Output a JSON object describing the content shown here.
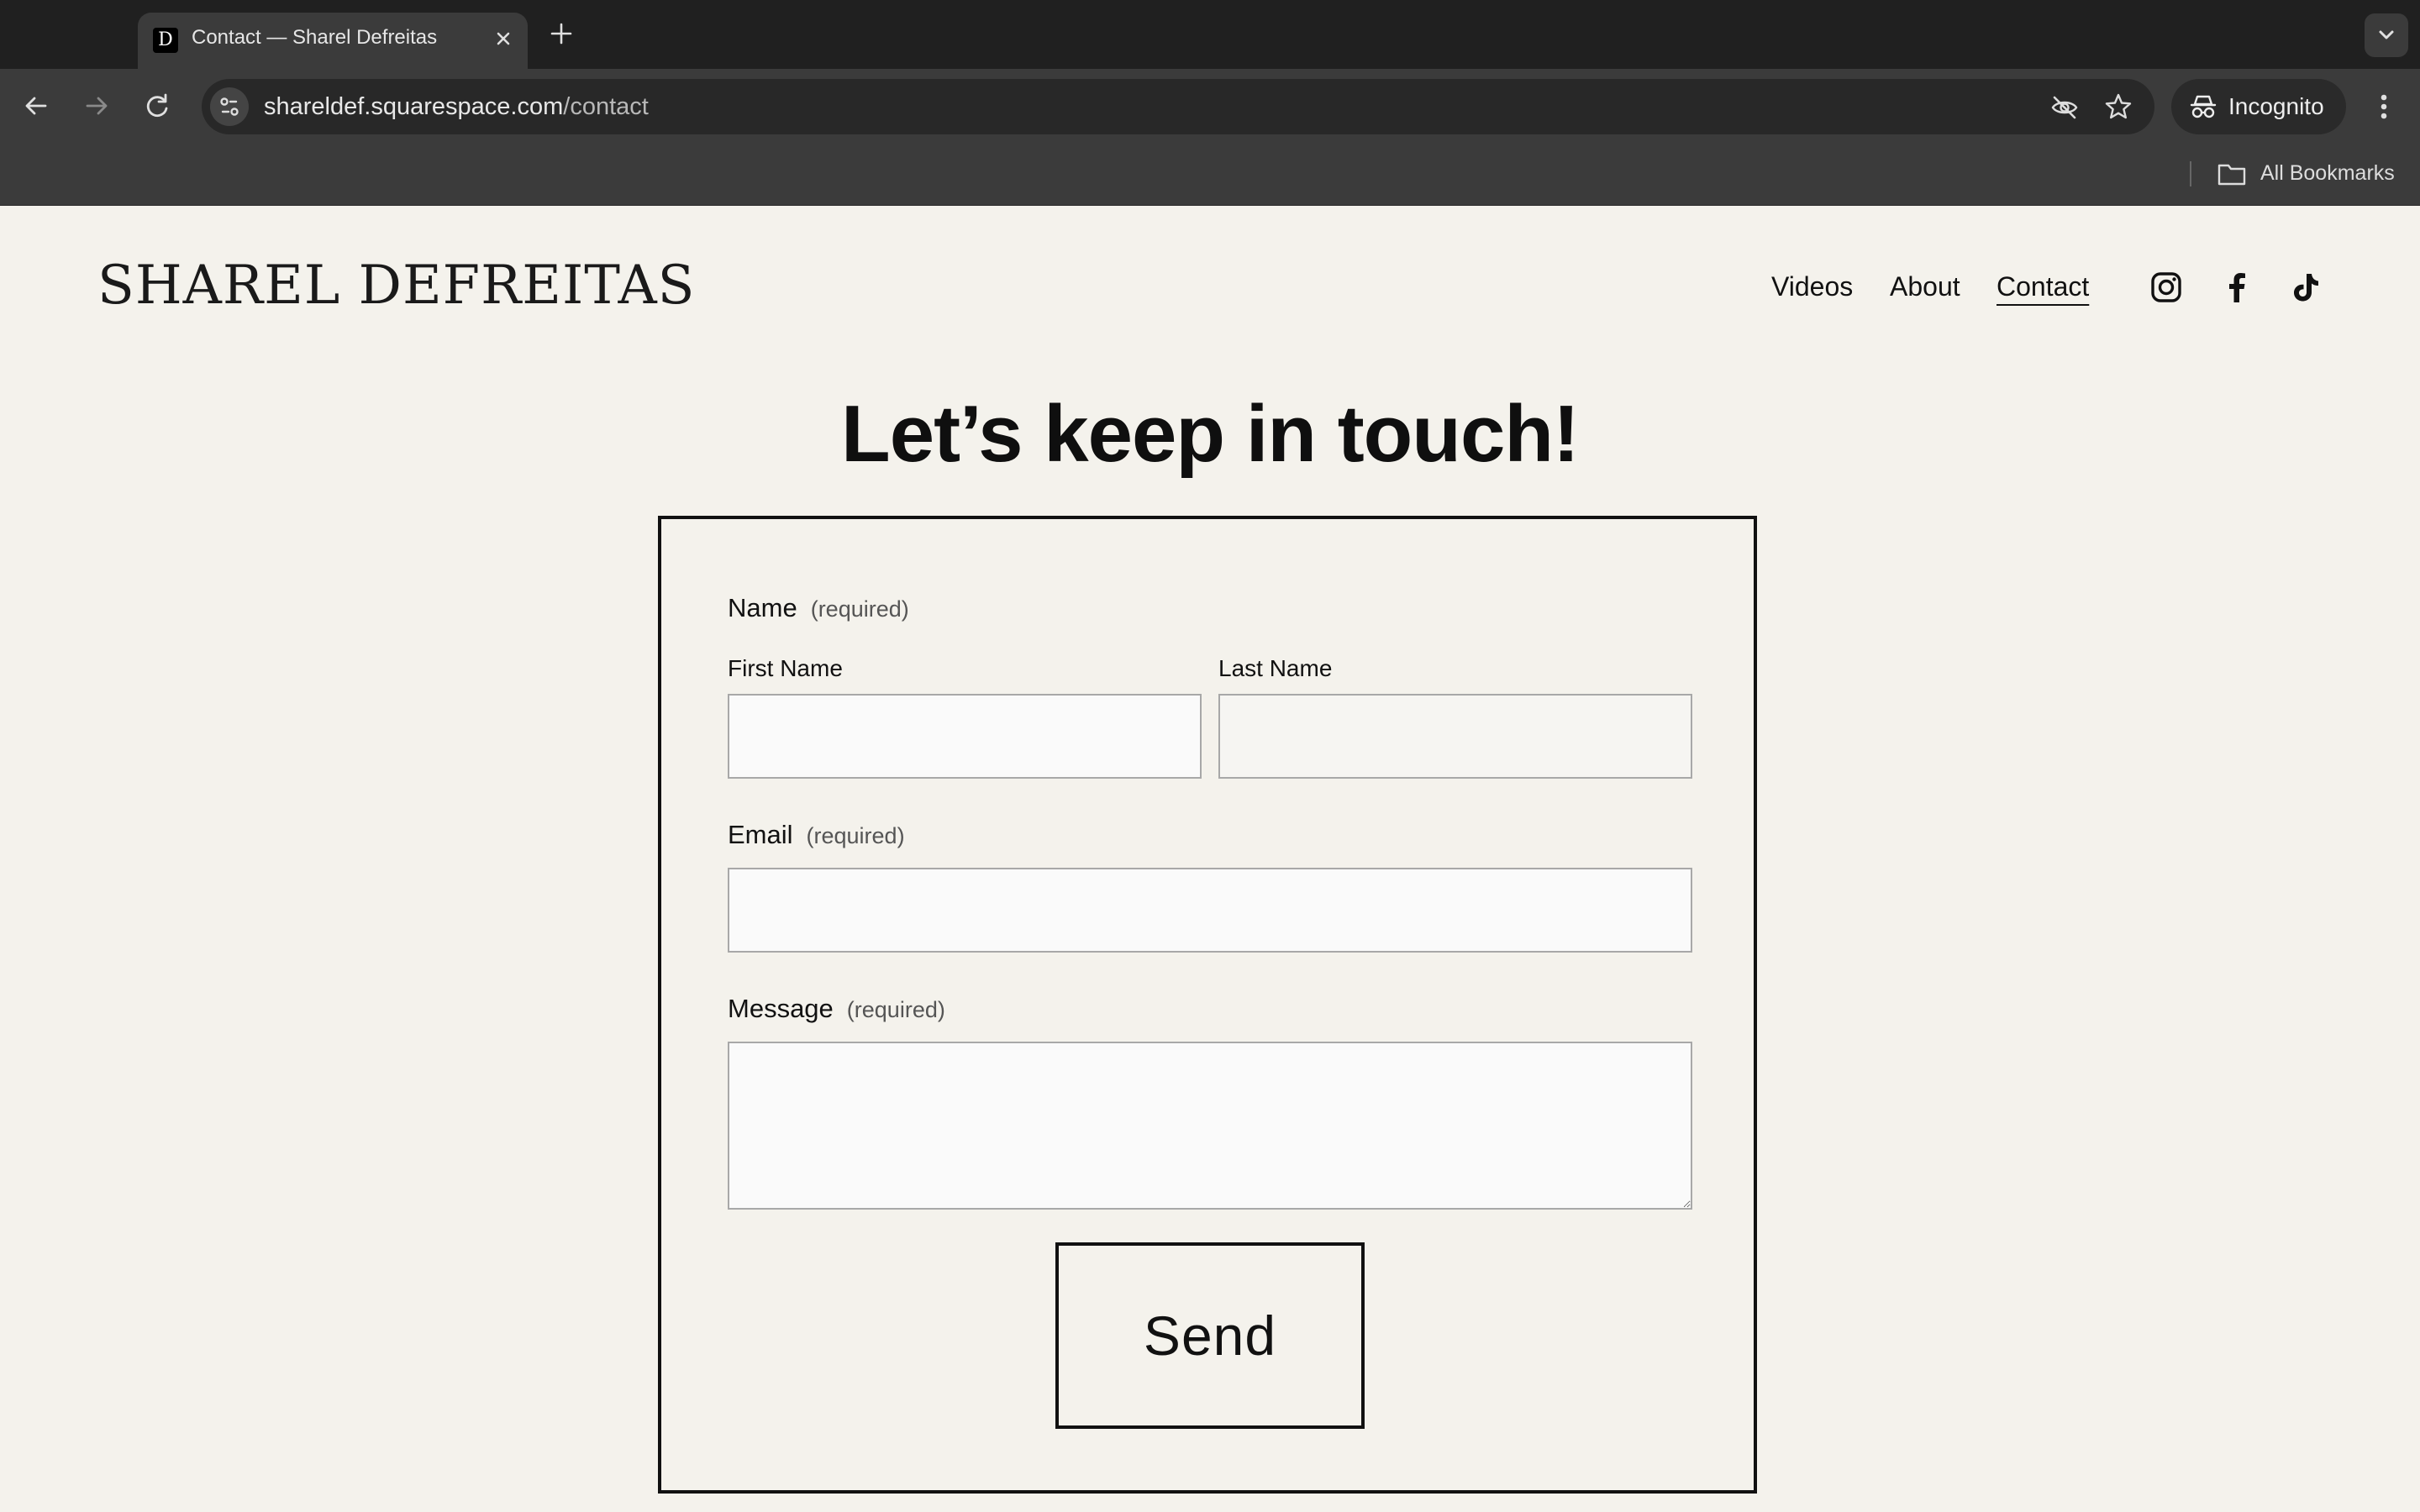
{
  "browser": {
    "tab_title": "Contact — Sharel Defreitas",
    "favicon_glyph": "D",
    "url_host": "shareldef.squarespace.com",
    "url_path": "/contact",
    "incognito_label": "Incognito",
    "bookmarks_label": "All Bookmarks"
  },
  "site": {
    "logo": "SHAREL DEFREITAS",
    "nav": [
      "Videos",
      "About",
      "Contact"
    ],
    "active_nav": "Contact",
    "social": [
      "instagram-icon",
      "facebook-icon",
      "tiktok-icon"
    ]
  },
  "page": {
    "headline": "Let’s keep in touch!"
  },
  "form": {
    "name_label": "Name",
    "required_text": "(required)",
    "first_name_label": "First Name",
    "last_name_label": "Last Name",
    "email_label": "Email",
    "message_label": "Message",
    "first_name_value": "",
    "last_name_value": "",
    "email_value": "",
    "message_value": "",
    "send_label": "Send"
  },
  "colors": {
    "page_bg": "#f4f2ec",
    "text": "#111111",
    "chrome_dark": "#202020",
    "chrome_toolbar": "#3b3b3b"
  }
}
